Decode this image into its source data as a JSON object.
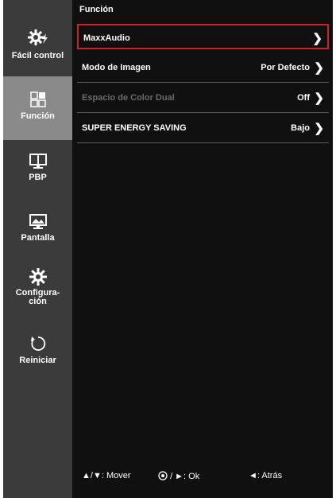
{
  "sidebar": {
    "items": [
      {
        "label": "Fácil control",
        "icon": "gear-bolt-icon",
        "active": false
      },
      {
        "label": "Función",
        "icon": "function-grid-icon",
        "active": true
      },
      {
        "label": "PBP",
        "icon": "pbp-monitor-icon",
        "active": false
      },
      {
        "label": "Pantalla",
        "icon": "screen-image-icon",
        "active": false
      },
      {
        "label": "Configura-\nción",
        "icon": "gear-icon",
        "active": false
      },
      {
        "label": "Reiniciar",
        "icon": "reset-icon",
        "active": false
      }
    ]
  },
  "panel": {
    "title": "Función",
    "rows": [
      {
        "label": "MaxxAudio",
        "value": "",
        "state": "selected"
      },
      {
        "label": "Modo de Imagen",
        "value": "Por Defecto",
        "state": "normal"
      },
      {
        "label": "Espacio de Color Dual",
        "value": "Off",
        "state": "disabled"
      },
      {
        "label": "SUPER ENERGY SAVING",
        "value": "Bajo",
        "state": "normal"
      }
    ]
  },
  "footer": {
    "move": "▲/▼: Mover",
    "ok": "/ ►: Ok",
    "back": "◄: Atrás"
  },
  "colors": {
    "sidebar_bg": "#3b3b3b",
    "sidebar_active": "#8a8a8a",
    "panel_bg": "#101010",
    "selection": "#d0202a"
  }
}
